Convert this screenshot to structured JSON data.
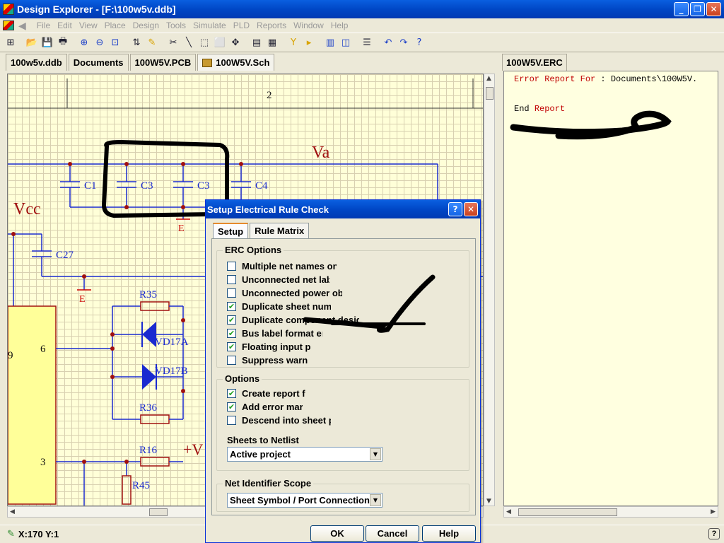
{
  "window": {
    "title": "Design Explorer - [F:\\100w5v.ddb]",
    "minimize": "_",
    "maximize": "❐",
    "close": "✕"
  },
  "menu": [
    "File",
    "Edit",
    "View",
    "Place",
    "Design",
    "Tools",
    "Simulate",
    "PLD",
    "Reports",
    "Window",
    "Help"
  ],
  "tabs": [
    {
      "label": "100w5v.ddb"
    },
    {
      "label": "Documents"
    },
    {
      "label": "100W5V.PCB"
    },
    {
      "label": "100W5V.Sch"
    }
  ],
  "erc_tab": "100W5V.ERC",
  "erc_report": {
    "line1_prefix": "Error Report For",
    "line1_rest": ": Documents\\100W5V.",
    "line2_prefix": "End ",
    "line2_rest": "Report"
  },
  "schematic": {
    "border_number": "2",
    "labels": {
      "va": "Va",
      "vcc": "Vcc",
      "c1": "C1",
      "c3a": "C3",
      "c3b": "C3",
      "c4": "C4",
      "c27": "C27",
      "e1": "E",
      "e2": "E",
      "r35": "R35",
      "vd17a": "VD17A",
      "vd17b": "VD17B",
      "r36": "R36",
      "r16": "R16",
      "r45": "R45",
      "pin6": "6",
      "pin3": "3",
      "pin9": "9",
      "plusv": "+V"
    }
  },
  "status": {
    "coords": "X:170 Y:1",
    "help": "?"
  },
  "dialog": {
    "title": "Setup Electrical Rule Check",
    "help_btn": "?",
    "close_btn": "✕",
    "tabs": {
      "setup": "Setup",
      "rule_matrix": "Rule Matrix"
    },
    "erc_options": {
      "label": "ERC Options",
      "items": [
        {
          "label": "Multiple net names on net",
          "checked": false
        },
        {
          "label": "Unconnected net labels",
          "checked": false
        },
        {
          "label": "Unconnected power objects",
          "checked": false
        },
        {
          "label": "Duplicate sheet numbers",
          "checked": true
        },
        {
          "label": "Duplicate component designators",
          "checked": true
        },
        {
          "label": "Bus label format errors",
          "checked": true
        },
        {
          "label": "Floating input pins",
          "checked": true
        },
        {
          "label": "Suppress warnings",
          "checked": false
        }
      ]
    },
    "options": {
      "label": "Options",
      "items": [
        {
          "label": "Create report file",
          "checked": true
        },
        {
          "label": "Add error markers",
          "checked": true
        },
        {
          "label": "Descend into sheet parts",
          "checked": false
        }
      ],
      "sheets_label": "Sheets to Netlist",
      "sheets_value": "Active project"
    },
    "scope": {
      "label": "Net Identifier Scope",
      "value": "Sheet Symbol / Port Connections"
    },
    "buttons": {
      "ok": "OK",
      "cancel": "Cancel",
      "help": "Help"
    }
  },
  "colors": {
    "accent_title": "#0047c6",
    "schematic_bg": "#ffffd8",
    "wire": "#1a2ad0",
    "label_red": "#a01010",
    "erc_text_red": "#c00000"
  }
}
